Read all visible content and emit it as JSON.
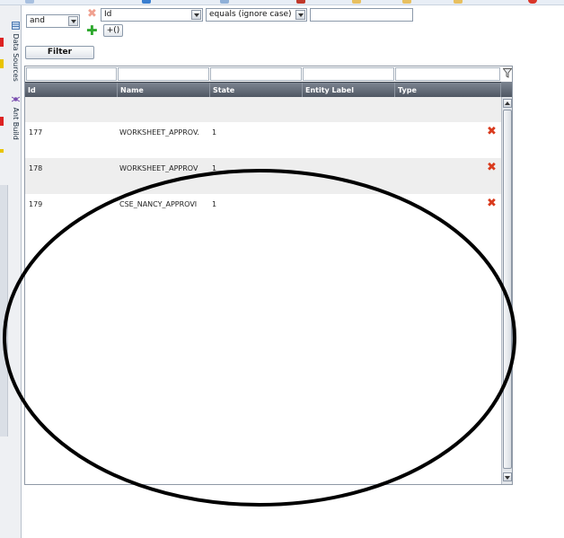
{
  "side_tabs": [
    {
      "label": "Data Sources",
      "icon": "data-sources-icon"
    },
    {
      "label": "Ant Build",
      "icon": "ant-icon"
    }
  ],
  "filter": {
    "conjunction": "and",
    "field": "Id",
    "operator": "equals (ignore case)",
    "value": "",
    "group_button": "+()",
    "filter_button": "Filter"
  },
  "grid": {
    "columns": [
      "Id",
      "Name",
      "State",
      "Entity Label",
      "Type"
    ],
    "rows": [
      {
        "id": "",
        "name": "",
        "state": "",
        "entity_label": "",
        "type": ""
      },
      {
        "id": "177",
        "name": "WORKSHEET_APPROV.",
        "state": "1",
        "entity_label": "",
        "type": ""
      },
      {
        "id": "178",
        "name": "WORKSHEET_APPROV",
        "state": "1",
        "entity_label": "",
        "type": ""
      },
      {
        "id": "179",
        "name": "CSE_NANCY_APPROVI",
        "state": "1",
        "entity_label": "",
        "type": ""
      }
    ]
  },
  "colors": {
    "header_bg": "#5a626e",
    "alt_row": "#eeeeee",
    "delete_icon": "#d93a1d",
    "add_icon": "#2ea82e",
    "annotation": "#000000"
  }
}
